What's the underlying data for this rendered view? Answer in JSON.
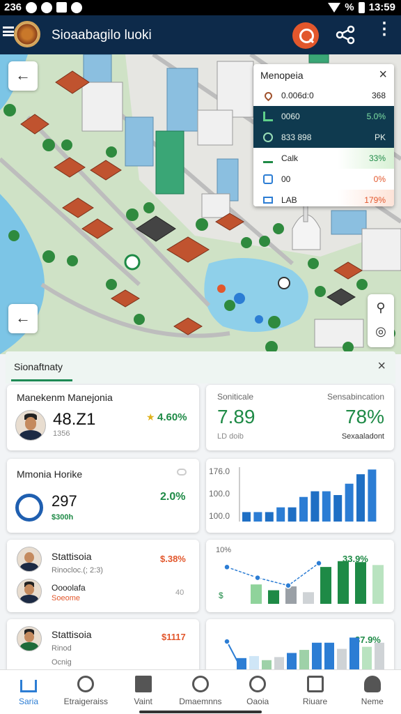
{
  "status": {
    "left_time": "236",
    "right_time": "13:59",
    "battery": "%"
  },
  "appbar": {
    "title": "Sioaabagilo luoki"
  },
  "map": {
    "back_button": "←",
    "back_button_2": "←",
    "popup": {
      "title": "Menopeia",
      "close": "×",
      "rows": [
        {
          "label": "0.006d:0",
          "value": "368"
        },
        {
          "label": "0060",
          "value": "5.0%"
        },
        {
          "label": "833 898",
          "value": "PK"
        },
        {
          "label": "Calk",
          "value": "33%"
        },
        {
          "label": "00",
          "value": "0%"
        },
        {
          "label": "LAB",
          "value": "179%"
        }
      ]
    }
  },
  "panel": {
    "title": "Sionaftnaty",
    "close": "×"
  },
  "cards": {
    "c1": {
      "name": "Manekenm Manejonia",
      "value": "48.Z1",
      "change": "4.60%",
      "sub": "1356"
    },
    "c2": {
      "label_left": "Soniticale",
      "label_right": "Sensabincation",
      "value_left": "7.89",
      "value_right": "78%",
      "sub_left": "LD doib",
      "sub_right": "Sexaaladont"
    },
    "c3": {
      "name": "Mmonia Horike",
      "value": "297",
      "change": "2.0%",
      "sub": "$300h"
    },
    "c4": {
      "name": "Stattisoia",
      "sub": "Rinocloc.(; 2:3)",
      "name2": "Oooolafa",
      "sub2": "Soeome",
      "value": "$.38%",
      "value2": "40"
    },
    "c5": {
      "name": "Stattisoia",
      "sub": "Rinod",
      "sub2": "Ocnig",
      "value": "$1117"
    }
  },
  "chart_data": [
    {
      "type": "bar",
      "ylabels": [
        "176.0",
        "100.0",
        "100.0"
      ],
      "values": [
        1,
        1,
        1,
        1.5,
        1.5,
        2.6,
        3.2,
        3.2,
        2.8,
        4,
        5,
        5.5
      ]
    },
    {
      "type": "bar",
      "ylabels": [
        "10%"
      ],
      "title_value": "33.9%",
      "values": [
        2,
        1.4,
        1.8,
        1.2,
        3.8,
        4.4,
        4.3,
        4.0
      ],
      "line": [
        3.5,
        2.4,
        1.6,
        3.9
      ]
    },
    {
      "type": "bar",
      "title_value": "37.9%",
      "values": [
        1.1,
        1.3,
        0.9,
        1.2,
        1.6,
        1.9,
        2.6,
        2.6,
        2.0,
        3.1,
        2.2,
        2.6
      ]
    }
  ],
  "nav": [
    {
      "label": "Saria",
      "icon": "home-icon",
      "active": true
    },
    {
      "label": "Etraigeraiss",
      "icon": "smile-icon"
    },
    {
      "label": "Vaint",
      "icon": "building-icon"
    },
    {
      "label": "Dmaemnns",
      "icon": "face-icon"
    },
    {
      "label": "Oaoia",
      "icon": "chat-icon"
    },
    {
      "label": "Riuare",
      "icon": "store-icon"
    },
    {
      "label": "Neme",
      "icon": "user-icon"
    }
  ],
  "colors": {
    "accent": "#1e8a55",
    "appbar": "#0d2a4a",
    "search": "#e2572c",
    "blue": "#2c7dd4",
    "green": "#1e8a46"
  }
}
